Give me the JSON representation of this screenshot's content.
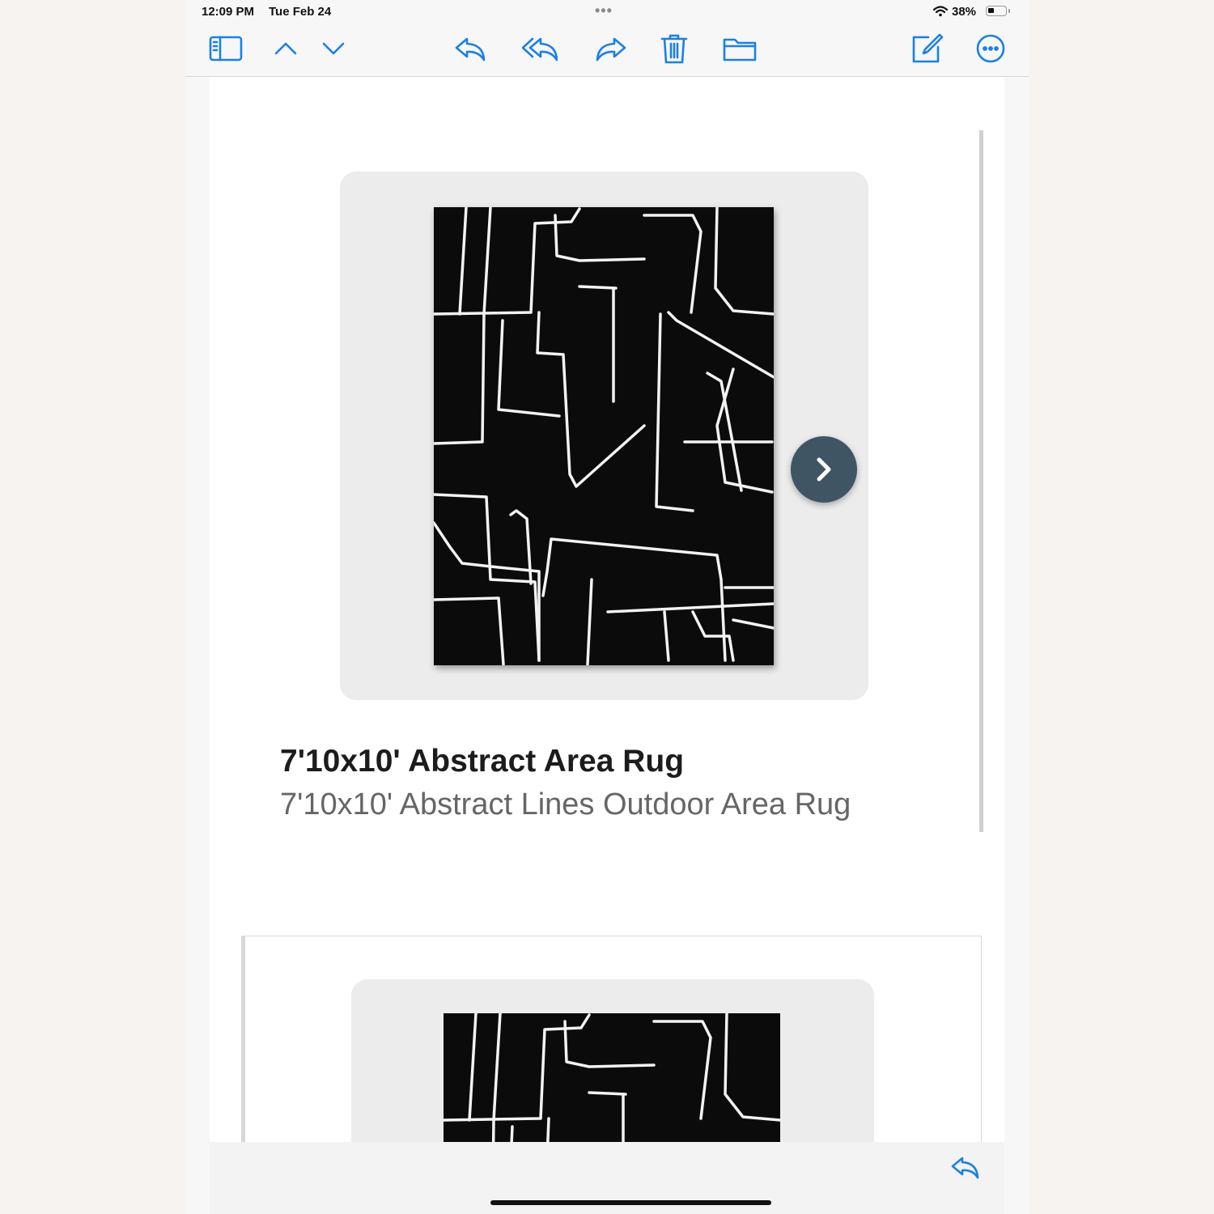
{
  "status_bar": {
    "time": "12:09 PM",
    "date": "Tue Feb 24",
    "battery_text": "38%",
    "battery_level": 0.38
  },
  "toolbar": {
    "icons": [
      "sidebar-icon",
      "chevron-up-icon",
      "chevron-down-icon",
      "reply-icon",
      "reply-all-icon",
      "forward-icon",
      "trash-icon",
      "folder-icon",
      "compose-icon",
      "more-icon"
    ],
    "accent_color": "#1a80e6"
  },
  "product": {
    "title": "7'10x10' Abstract Area Rug",
    "subtitle": "7'10x10' Abstract Lines Outdoor Area Rug",
    "next_button_icon": "chevron-right-icon",
    "next_button_color": "#3f5563"
  },
  "bottom_bar": {
    "reply_icon": "reply-icon"
  }
}
